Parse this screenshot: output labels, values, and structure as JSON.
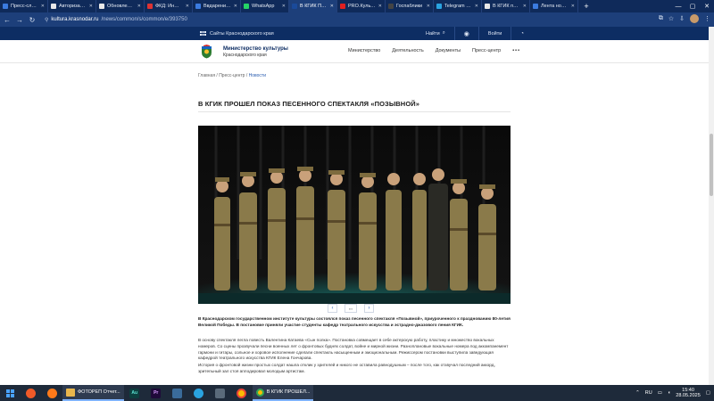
{
  "browser": {
    "tabs": [
      {
        "label": "Пресс-служба",
        "color": "#3b7be0"
      },
      {
        "label": "Авторизация",
        "color": "#e8e8e8"
      },
      {
        "label": "Обновление ст",
        "color": "#e8e8e8"
      },
      {
        "label": "ФКД: Информ",
        "color": "#d33"
      },
      {
        "label": "Ввдарение - П",
        "color": "#3b7be0"
      },
      {
        "label": "WhatsApp",
        "color": "#25d366"
      },
      {
        "label": "В КГИК ПРОШ",
        "color": "#1a4a9a",
        "active": true
      },
      {
        "label": "PRO.Культура.Р",
        "color": "#e02020"
      },
      {
        "label": "Госпаблики",
        "color": "#444"
      },
      {
        "label": "Telegram Web",
        "color": "#2aa3e0"
      },
      {
        "label": "В КГИК прош",
        "color": "#e8e8e8"
      },
      {
        "label": "Лента новостей",
        "color": "#3b7be0"
      }
    ],
    "url_host": "kultura.krasnodar.ru",
    "url_path": "/news/common/s/common/e/393750"
  },
  "sitebar": {
    "portal_label": "Сайты Краснодарского края",
    "search_label": "Найти",
    "login_label": "Войти"
  },
  "header": {
    "org_name": "Министерство культуры",
    "org_region": "Краснодарского края",
    "nav": [
      "Министерство",
      "Деятельность",
      "Документы",
      "Пресс-центр"
    ],
    "more_label": "•••"
  },
  "breadcrumb": {
    "home": "Главная",
    "section": "Пресс-центр",
    "current": "Новости",
    "sep": " / "
  },
  "article": {
    "title": "В КГИК ПРОШЕЛ ПОКАЗ ПЕСЕННОГО СПЕКТАКЛЯ «ПОЗЫВНОЙ»",
    "lead": "В Краснодарском государственном институте культуры состоялся показ песенного спектакля «Позывной», приуроченного к празднованию 80-летия Великой Победы. В постановке приняли участие студенты кафедр театрального искусства и эстрадно-джазового пения КГИК.",
    "p2": "В основу спектакля легла повесть Валентина Катаева «Сын полка». Постановка совмещает в себе актерскую работу, пластику и множество вокальных номеров. Со сцены прозвучали песни военных лет о фронтовых буднях солдат, войне и мирной жизни. Разноплановые вокальные номера под аккомпанемент гармони и гитары, сольное и хоровое исполнение сделали спектакль насыщенным и эмоциональным. Режиссером постановки выступила заведующая кафедрой театрального искусства КГИК Елена Гончарова.",
    "p3": "История о фронтовой жизни простых солдат нашла отклик у зрителей и никого не оставила равнодушным – после того, как отзвучал последний аккорд, зрительный зал стоя аплодировал молодым артистам."
  },
  "gallery": {
    "prev": "‹",
    "next": "›"
  },
  "taskbar": {
    "items": [
      {
        "label": "ФОТОРЕП Отчет...",
        "color": "#e8b64c"
      },
      {
        "label": "Au",
        "color": "#1d5a5a"
      },
      {
        "label": "Pr",
        "color": "#2a0a4a"
      },
      {
        "label": "В КГИК ПРОШЕЛ...",
        "color": "#3a7be0"
      }
    ],
    "lang": "RU",
    "time": "15:40",
    "date": "28.05.2025"
  }
}
